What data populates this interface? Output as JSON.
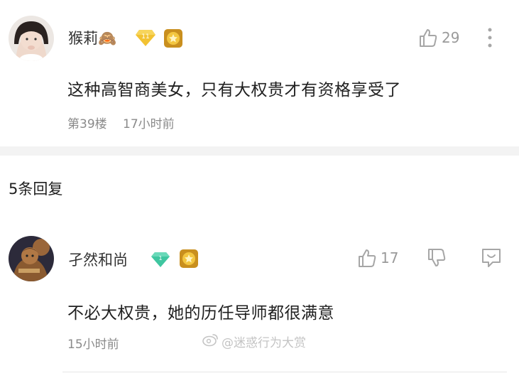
{
  "comment": {
    "username": "猴莉🙈",
    "level_badge": "11",
    "text": "这种高智商美女，只有大权贵才有资格享受了",
    "floor": "第39楼",
    "time": "17小时前",
    "likes": "29"
  },
  "replies": {
    "heading": "5条回复",
    "items": [
      {
        "username": "孑然和尚",
        "text": "不必大权贵，她的历任导师都很满意",
        "time": "15小时前",
        "likes": "17"
      }
    ]
  },
  "watermark": "@迷惑行为大赏",
  "colors": {
    "gold_badge": "#f2c232",
    "green_badge": "#3fc6a0",
    "medal": "#d9a928",
    "icon_gray": "#a6a6a6"
  }
}
